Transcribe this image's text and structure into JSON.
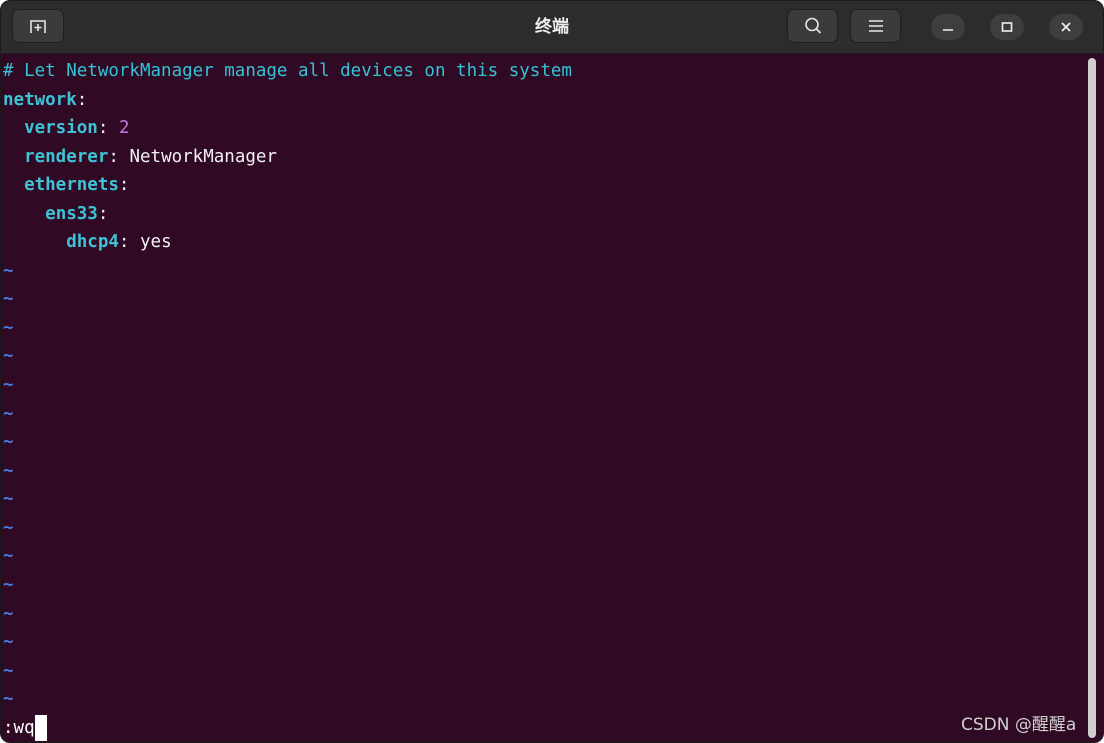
{
  "window": {
    "title": "终端"
  },
  "titlebar": {
    "new_tab_icon": "new-tab-icon",
    "search_icon": "search-icon",
    "menu_icon": "hamburger-menu-icon",
    "minimize_icon": "minimize-icon",
    "maximize_icon": "maximize-icon",
    "close_icon": "close-icon"
  },
  "editor": {
    "comment": "# Let NetworkManager manage all devices on this system",
    "network_key": "network",
    "version_key": "version",
    "version_value": "2",
    "renderer_key": "renderer",
    "renderer_value": "NetworkManager",
    "ethernets_key": "ethernets",
    "iface_key": "ens33",
    "dhcp_key": "dhcp4",
    "dhcp_value": "yes",
    "colon": ":",
    "empty_line_marker": "~",
    "command": ":wq"
  },
  "watermark": "CSDN @醒醒a",
  "colors": {
    "terminal_bg": "#300a24",
    "comment": "#34c3d6",
    "key": "#3ec3d6",
    "number": "#c678dd",
    "tilde": "#4a78d6",
    "titlebar_bg": "#2c2c2c"
  }
}
